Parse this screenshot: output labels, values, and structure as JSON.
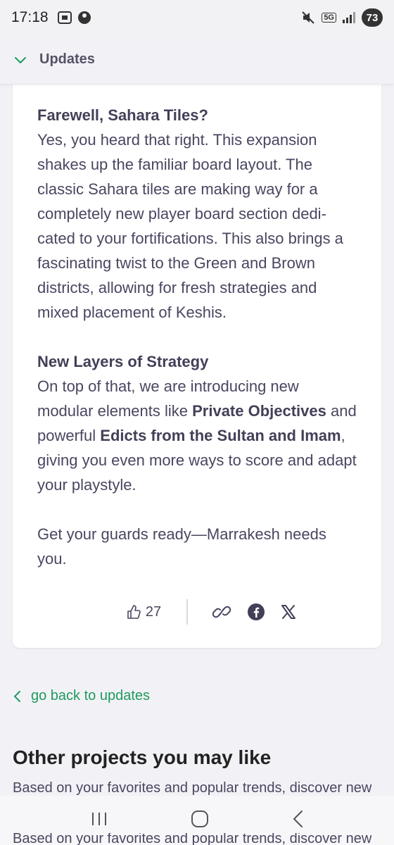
{
  "status_bar": {
    "time": "17:18",
    "network": "5G",
    "battery": "73"
  },
  "updates_header": {
    "label": "Updates",
    "accent": "#1e9a5e"
  },
  "article": {
    "para1_heading": "Farewell, Sahara Tiles?",
    "para1_body": "Yes, you heard that right. This expansion shakes up the familiar board layout. The classic Sahara tiles are making way for a completely new player board section dedi-cated to your fortifications. This also brings a fascinating twist to the Green and Brown districts, allowing for fresh strategies and mixed placement of Keshis.",
    "para2_heading": "New Layers of Strategy",
    "para2_body_a": "On top of that, we are introducing new modular elements like ",
    "para2_bold_1": "Private Objectives",
    "para2_body_b": " and powerful ",
    "para2_bold_2": "Edicts from the Sultan and Imam",
    "para2_body_c": ", giving you even more ways to score and adapt your playstyle.",
    "para3": "Get your guards ready—Marrakesh needs you."
  },
  "actions": {
    "like_count": "27",
    "icons": [
      "thumbs-up-icon",
      "link-icon",
      "facebook-icon",
      "x-icon"
    ]
  },
  "back_link": {
    "label": "go back to updates"
  },
  "other_projects": {
    "title": "Other projects you may like",
    "subtitle": "Based on your favorites and popular trends, discover new",
    "ghost_subtitle": "Based on your favorites and popular trends, discover new"
  },
  "nav": {
    "icons": [
      "recent-apps-icon",
      "home-icon",
      "back-icon"
    ]
  }
}
